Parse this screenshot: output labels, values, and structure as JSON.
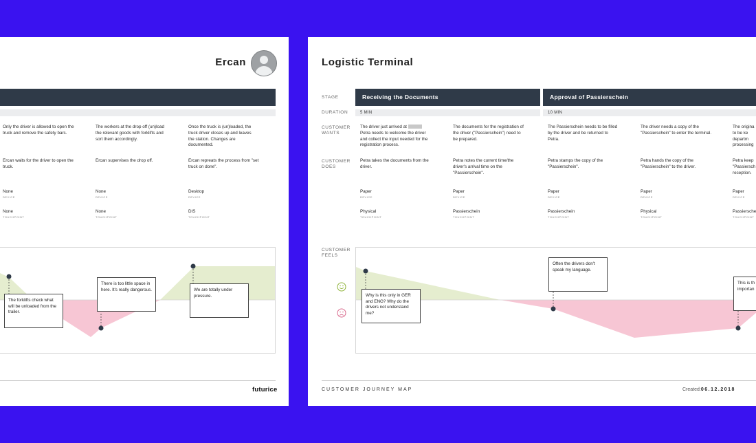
{
  "colors": {
    "background": "#3a12f0",
    "stage_bar": "#2f3a48",
    "positive_area": "#e5edcf",
    "negative_area": "#f7c6d4",
    "dot": "#2f3a48"
  },
  "left_page": {
    "title": "Ercan",
    "columns": [
      {
        "wants": "Only the driver is allowed to open the truck and remove the safety bars.",
        "does": "Ercan waits for the driver to open the truck.",
        "device": "None",
        "device_label": "DEVICE",
        "touchpoint": "None",
        "touchpoint_label": "TOUCHPOINT"
      },
      {
        "wants": "The workers at the drop off (un)load the relevant goods with forklifts and sort them accordingly.",
        "does": "Ercan supervises the drop off.",
        "device": "None",
        "device_label": "DEVICE",
        "touchpoint": "None",
        "touchpoint_label": "TOUCHPOINT"
      },
      {
        "wants": "Once the truck is (un)loaded, the truck driver closes up and leaves the station. Changes are documented.",
        "does": "Ercan repreats the process from \"set truck on done\".",
        "device": "Desktop",
        "device_label": "DEVICE",
        "touchpoint": "DIS",
        "touchpoint_label": "TOUCHPOINT"
      }
    ],
    "notes": [
      "The forklifts check what will be unloaded from the trailer.",
      "There is too little space in here. It's really dangerous.",
      "We are totally under pressure."
    ],
    "logo": "futurice"
  },
  "right_page": {
    "title": "Logistic Terminal",
    "row_labels": {
      "stage": "STAGE",
      "duration": "DURATION",
      "wants": "CUSTOMER WANTS",
      "does": "CUSTOMER DOES",
      "feels": "CUSTOMER FEELS"
    },
    "stages": [
      {
        "name": "Receiving the Documents",
        "duration": "5 MIN"
      },
      {
        "name": "Approval of Passierschein",
        "duration": "10 MIN"
      }
    ],
    "columns": [
      {
        "wants_prefix": "The driver just arrived at",
        "wants_rest": "Petra needs to welcome the driver and collect the input needed for the registration process.",
        "does": "Petra takes the documents from the driver.",
        "device": "Paper",
        "device_label": "DEVICE",
        "touchpoint": "Physical",
        "touchpoint_label": "TOUCHPOINT"
      },
      {
        "wants": "The documents for the registration of the driver (\"Passierschein\") need to be prepared.",
        "does": "Petra notes the current time/the driver's arrival time on the \"Passierschein\".",
        "device": "Paper",
        "device_label": "DEVICE",
        "touchpoint": "Passierschein",
        "touchpoint_label": "TOUCHPOINT"
      },
      {
        "wants": "The Passierschein needs to be filled by the driver and be returned to Petra.",
        "does": "Petra stamps the copy of the \"Passierschein\".",
        "device": "Paper",
        "device_label": "DEVICE",
        "touchpoint": "Passierschein",
        "touchpoint_label": "TOUCHPOINT"
      },
      {
        "wants": "The driver needs a copy of the \"Passierschein\" to enter the terminal.",
        "does": "Petra hands the copy of the \"Passierschein\" to the driver.",
        "device": "Paper",
        "device_label": "DEVICE",
        "touchpoint": "Physical",
        "touchpoint_label": "TOUCHPOINT"
      },
      {
        "wants": "The origina to be ke departm processing",
        "does": "Petra keep \"Passiersch reception.",
        "device": "Paper",
        "device_label": "DEVICE",
        "touchpoint": "Passiersche",
        "touchpoint_label": "TOUCHPOINT"
      }
    ],
    "notes": [
      "Why is this only in GER and ENG? Why do the drivers not understand me?",
      "Often the drivers don't speak my language.",
      "This is th importan"
    ],
    "footer_left": "CUSTOMER JOURNEY MAP",
    "footer_created_label": "Created:",
    "footer_created_date": "06.12.2018"
  }
}
